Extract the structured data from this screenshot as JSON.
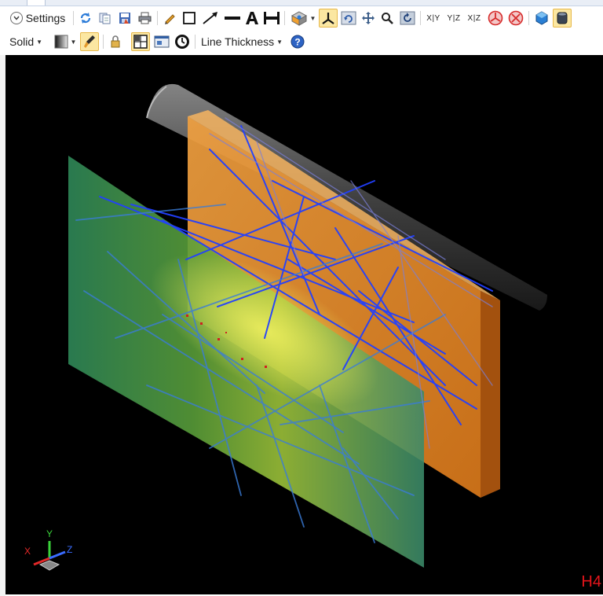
{
  "toolbar1": {
    "settings_label": "Settings",
    "axis_labels": [
      "X|Y",
      "Y|Z",
      "X|Z"
    ]
  },
  "toolbar2": {
    "render_mode": "Solid",
    "line_thickness_label": "Line Thickness"
  },
  "viewport": {
    "corner_label": "H4",
    "triad": {
      "x": "X",
      "y": "Y",
      "z": "Z"
    }
  },
  "colors": {
    "viewport_bg": "#000000",
    "detector_orange": "#e58a1f",
    "ray_blue": "#1f3cff",
    "active_button": "#fbe7a2",
    "corner_label": "#e4141b"
  }
}
